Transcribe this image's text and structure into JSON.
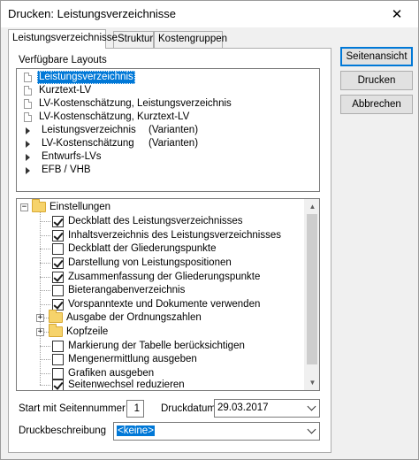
{
  "window": {
    "title": "Drucken: Leistungsverzeichnisse",
    "close_glyph": "✕"
  },
  "tabs": [
    {
      "label": "Leistungsverzeichnisse",
      "active": true
    },
    {
      "label": "Struktur",
      "active": false
    },
    {
      "label": "Kostengruppen",
      "active": false
    }
  ],
  "layouts": {
    "label": "Verfügbare Layouts",
    "items": [
      {
        "label": "Leistungsverzeichnis",
        "icon": "document-icon",
        "selected": true
      },
      {
        "label": "Kurztext-LV",
        "icon": "document-icon"
      },
      {
        "label": "LV-Kostenschätzung, Leistungsverzeichnis",
        "icon": "document-icon"
      },
      {
        "label": "LV-Kostenschätzung, Kurztext-LV",
        "icon": "document-icon"
      },
      {
        "label": "Leistungsverzeichnis",
        "suffix": "(Varianten)",
        "icon": "expand-arrow-icon"
      },
      {
        "label": "LV-Kostenschätzung",
        "suffix": "(Varianten)",
        "icon": "expand-arrow-icon"
      },
      {
        "label": "Entwurfs-LVs",
        "icon": "expand-arrow-icon"
      },
      {
        "label": "EFB / VHB",
        "icon": "expand-arrow-icon"
      }
    ]
  },
  "settings": {
    "root": {
      "label": "Einstellungen",
      "expander": "−"
    },
    "items": [
      {
        "label": "Deckblatt des Leistungsverzeichnisses",
        "checked": true
      },
      {
        "label": "Inhaltsverzeichnis des Leistungsverzeichnisses",
        "checked": true
      },
      {
        "label": "Deckblatt der Gliederungspunkte",
        "checked": false
      },
      {
        "label": "Darstellung von Leistungspositionen",
        "checked": true
      },
      {
        "label": "Zusammenfassung der Gliederungspunkte",
        "checked": true
      },
      {
        "label": "Bieterangabenverzeichnis",
        "checked": false
      },
      {
        "label": "Vorspanntexte und Dokumente verwenden",
        "checked": true
      },
      {
        "label": "Ausgabe der Ordnungszahlen",
        "folder": true,
        "expander": "+"
      },
      {
        "label": "Kopfzeile",
        "folder": true,
        "expander": "+"
      },
      {
        "label": "Markierung der Tabelle berücksichtigen",
        "checked": false
      },
      {
        "label": "Mengenermittlung ausgeben",
        "checked": false
      },
      {
        "label": "Grafiken ausgeben",
        "checked": false
      },
      {
        "label": "Seitenwechsel reduzieren",
        "checked": true
      }
    ]
  },
  "form": {
    "start_label": "Start mit Seitennummer",
    "start_value": "1",
    "date_label": "Druckdatum",
    "date_value": "29.03.2017",
    "desc_label": "Druckbeschreibung",
    "desc_value": "<keine>"
  },
  "buttons": {
    "preview": "Seitenansicht",
    "print": "Drucken",
    "cancel": "Abbrechen"
  },
  "colors": {
    "selection": "#0078d7",
    "folder": "#f6d36b"
  }
}
